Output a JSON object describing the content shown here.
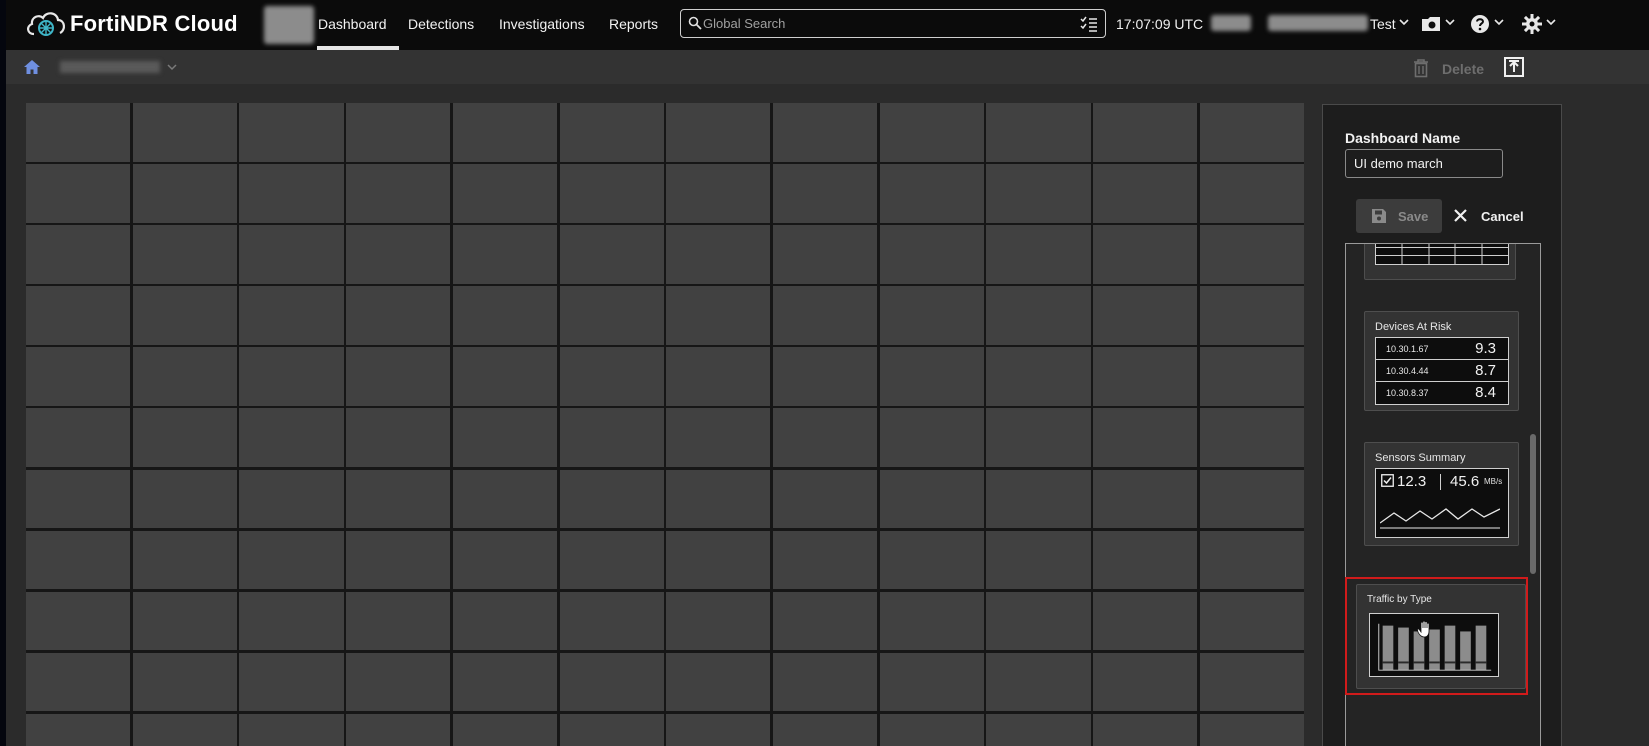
{
  "app": {
    "brand": "FortiNDR Cloud"
  },
  "nav": {
    "items": [
      {
        "label": "Dashboard",
        "active": true
      },
      {
        "label": "Detections",
        "active": false
      },
      {
        "label": "Investigations",
        "active": false
      },
      {
        "label": "Reports",
        "active": false
      }
    ]
  },
  "search": {
    "placeholder": "Global Search"
  },
  "header": {
    "clock": "17:07:09 UTC",
    "user_suffix": "Test"
  },
  "toolbar": {
    "delete_label": "Delete"
  },
  "panel": {
    "name_label": "Dashboard Name",
    "name_value": "UI demo march",
    "save_label": "Save",
    "cancel_label": "Cancel"
  },
  "widgets": {
    "devices_at_risk": {
      "title": "Devices At Risk",
      "rows": [
        {
          "ip": "10.30.1.67",
          "score": "9.3"
        },
        {
          "ip": "10.30.4.44",
          "score": "8.7"
        },
        {
          "ip": "10.30.8.37",
          "score": "8.4"
        }
      ]
    },
    "sensors_summary": {
      "title": "Sensors Summary",
      "count": "12.3",
      "rate": "45.6",
      "rate_unit": "MB/s"
    },
    "traffic_by_type": {
      "title": "Traffic by Type"
    }
  },
  "colors": {
    "highlight": "#d11b1b",
    "home_icon": "#6f8fe0",
    "canvas_cell": "#414141"
  }
}
